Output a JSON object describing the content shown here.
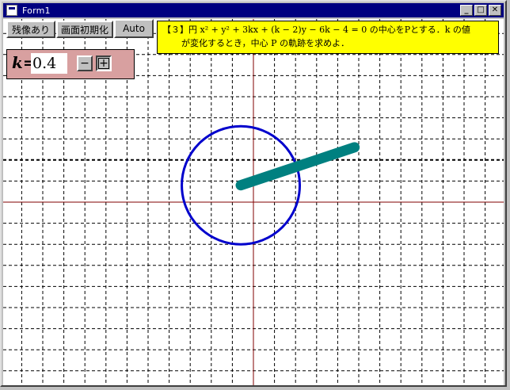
{
  "window": {
    "title": "Form1"
  },
  "controls": {
    "minimize": "_",
    "maximize": "□",
    "close": "✕"
  },
  "toolbar": {
    "afterimage_label": "残像あり",
    "reset_label": "画面初期化",
    "auto_label": "Auto"
  },
  "problem": {
    "line1": "【３】円 x² + y² + 3kx + (k − 2)y − 6k − 4 = 0 の中心をPとする．k の値",
    "line2": "が変化するとき，中心 P の軌跡を求めよ．"
  },
  "param": {
    "name": "k",
    "equals": "=",
    "value": "0.4",
    "minus_label": "−",
    "plus_label": "+"
  },
  "colors": {
    "circle": "#0000cc",
    "locus": "#008080",
    "axis": "#800000",
    "grid": "#000000",
    "panel": "#d8a0a0",
    "problem_bg": "#ffff00"
  },
  "chart_data": {
    "type": "scatter",
    "xlim": [
      -12,
      12
    ],
    "ylim": [
      -8.5,
      10.5
    ],
    "grid_step": 1,
    "k": 0.4,
    "circle": {
      "cx": -0.6,
      "cy": 0.8,
      "r": 2.8
    },
    "locus": {
      "from": [
        -0.6,
        0.8
      ],
      "to": [
        4.8,
        2.6
      ]
    }
  }
}
